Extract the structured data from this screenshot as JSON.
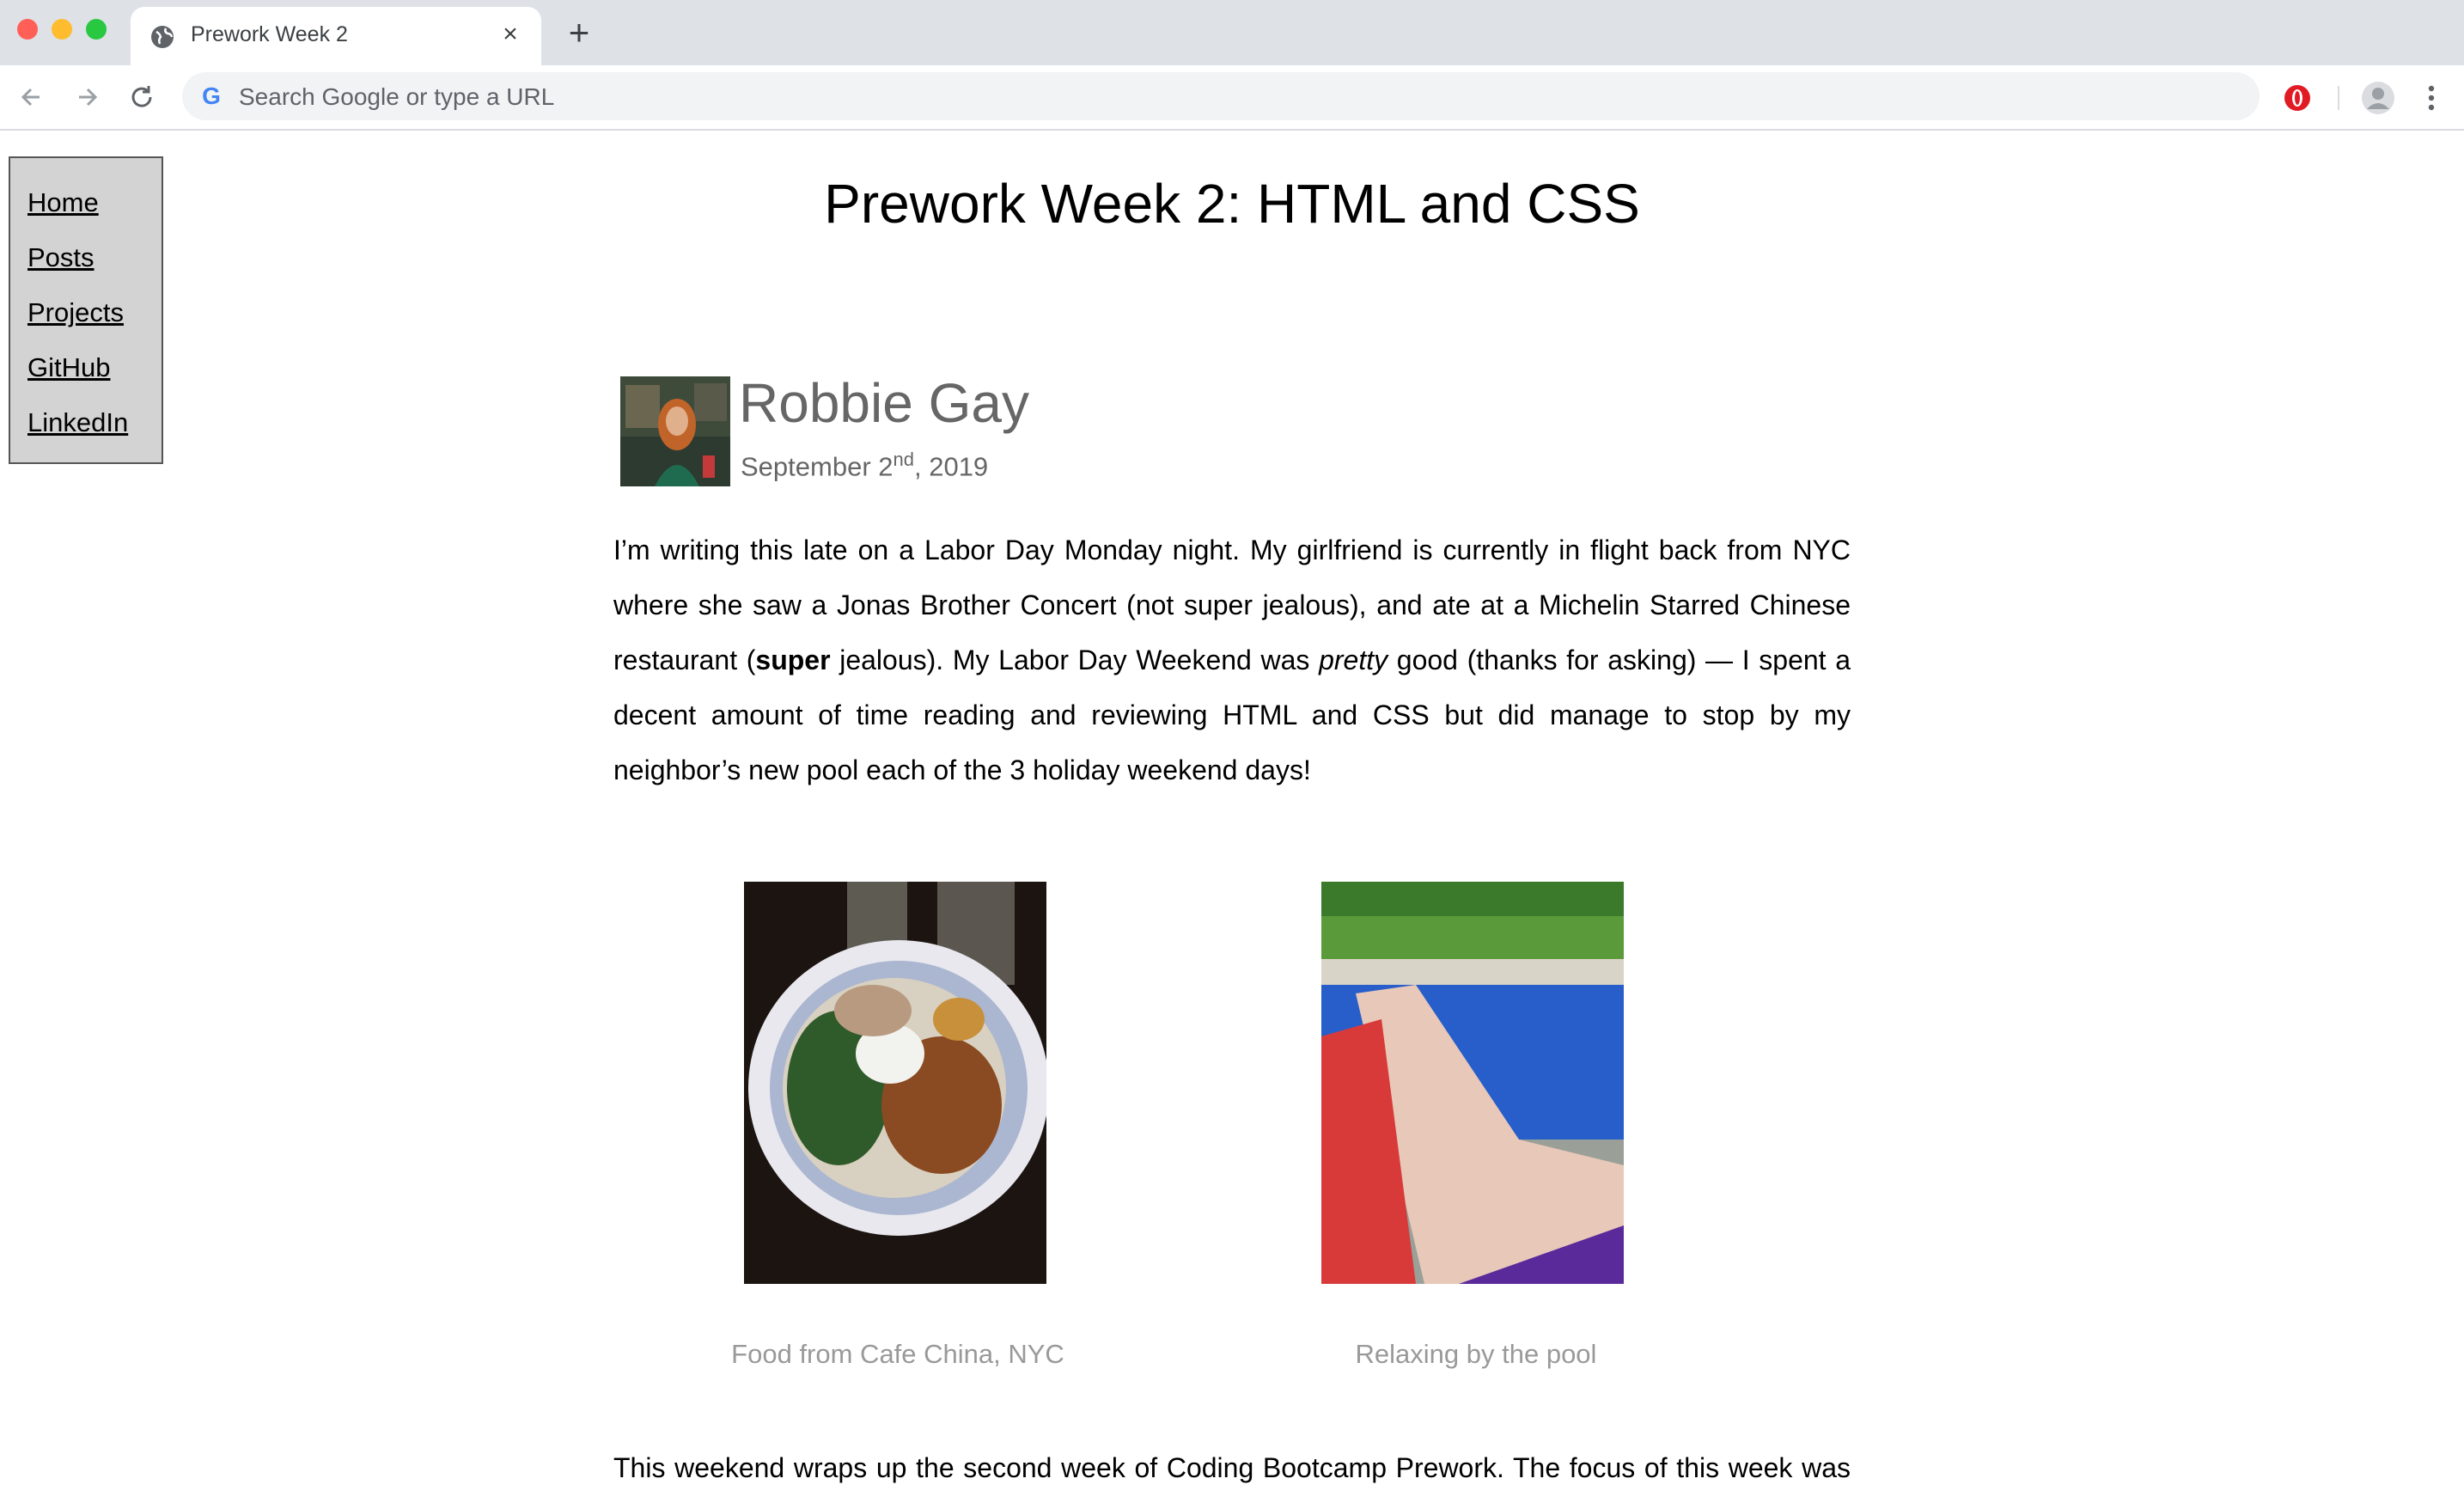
{
  "browser": {
    "tab_title": "Prework Week 2",
    "tab_close_label": "×",
    "new_tab_label": "+",
    "omnibox_placeholder": "Search Google or type a URL",
    "omnibox_logo": "G"
  },
  "site_nav": {
    "items": [
      {
        "label": "Home"
      },
      {
        "label": "Posts"
      },
      {
        "label": "Projects"
      },
      {
        "label": "GitHub"
      },
      {
        "label": "LinkedIn"
      }
    ]
  },
  "page": {
    "title": "Prework Week 2: HTML and CSS"
  },
  "post": {
    "author": "Robbie Gay",
    "date_prefix": "September 2",
    "date_sup": "nd",
    "date_suffix": ", 2019",
    "paragraph1": {
      "part1": "I’m writing this late on a Labor Day Monday night. My girlfriend is currently in flight back from NYC where she saw a Jonas Brother Concert (not super jealous), and ate at a Michelin Starred Chinese restaurant (",
      "bold": "super",
      "part2": " jealous). My Labor Day Weekend was ",
      "italic": "pretty",
      "part3": " good (thanks for asking) — I spent a decent amount of time reading and reviewing HTML and CSS but did manage to stop by my neighbor’s new pool each of the 3 holiday weekend days!"
    },
    "photos": [
      {
        "caption": "Food from Cafe China, NYC"
      },
      {
        "caption": "Relaxing by the pool"
      }
    ],
    "paragraph2": "This weekend wraps up the second week of Coding Bootcamp Prework. The focus of this week was"
  },
  "colors": {
    "nav_bg": "#d3d3d3",
    "muted_text": "#666666",
    "caption_text": "#999999"
  }
}
